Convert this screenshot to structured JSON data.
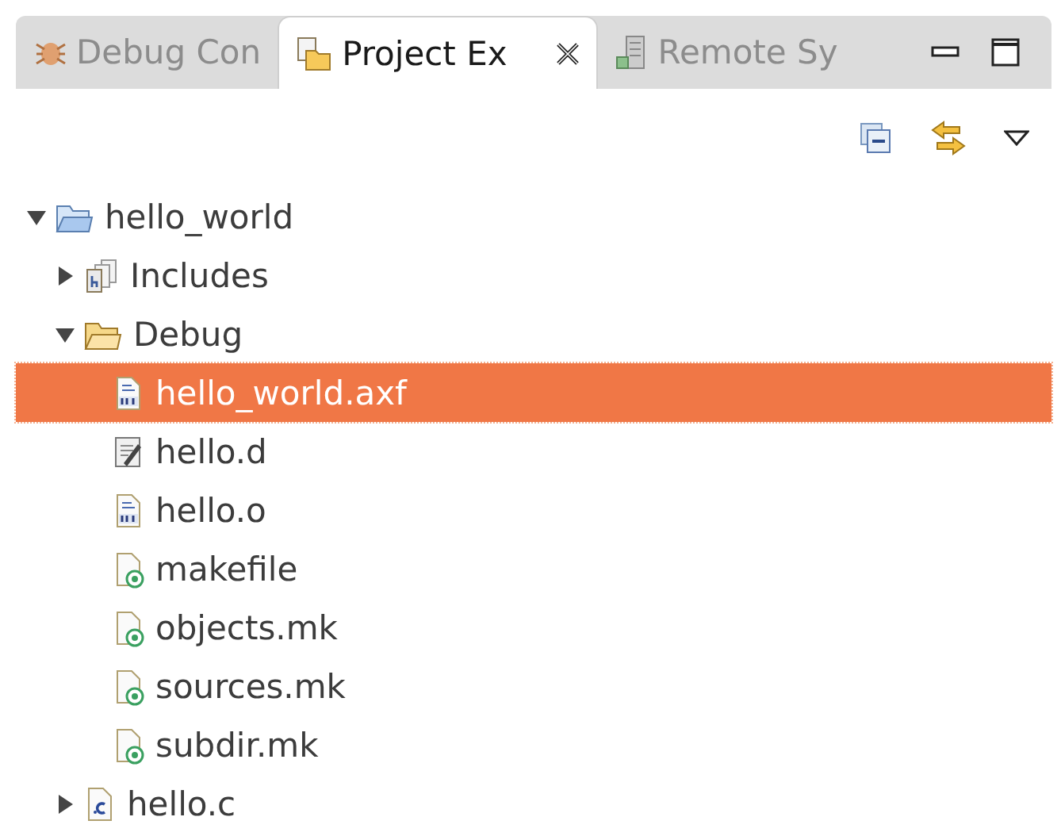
{
  "tabs": [
    {
      "label": "Debug Con",
      "kind": "debug",
      "selected": false
    },
    {
      "label": "Project Ex",
      "kind": "explorer",
      "selected": true
    },
    {
      "label": "Remote Sy",
      "kind": "remote",
      "selected": false
    }
  ],
  "tree": [
    {
      "label": "hello_world",
      "kind": "project",
      "expanded": true,
      "selected": false,
      "children": [
        {
          "label": "Includes",
          "kind": "includes",
          "expanded": false,
          "selected": false
        },
        {
          "label": "Debug",
          "kind": "folder",
          "expanded": true,
          "selected": false,
          "children": [
            {
              "label": "hello_world.axf",
              "kind": "binary",
              "selected": true
            },
            {
              "label": "hello.d",
              "kind": "dfile",
              "selected": false
            },
            {
              "label": "hello.o",
              "kind": "binary",
              "selected": false
            },
            {
              "label": "makefile",
              "kind": "make",
              "selected": false
            },
            {
              "label": "objects.mk",
              "kind": "make",
              "selected": false
            },
            {
              "label": "sources.mk",
              "kind": "make",
              "selected": false
            },
            {
              "label": "subdir.mk",
              "kind": "make",
              "selected": false
            }
          ]
        },
        {
          "label": "hello.c",
          "kind": "csource",
          "expanded": false,
          "selected": false
        }
      ]
    }
  ]
}
